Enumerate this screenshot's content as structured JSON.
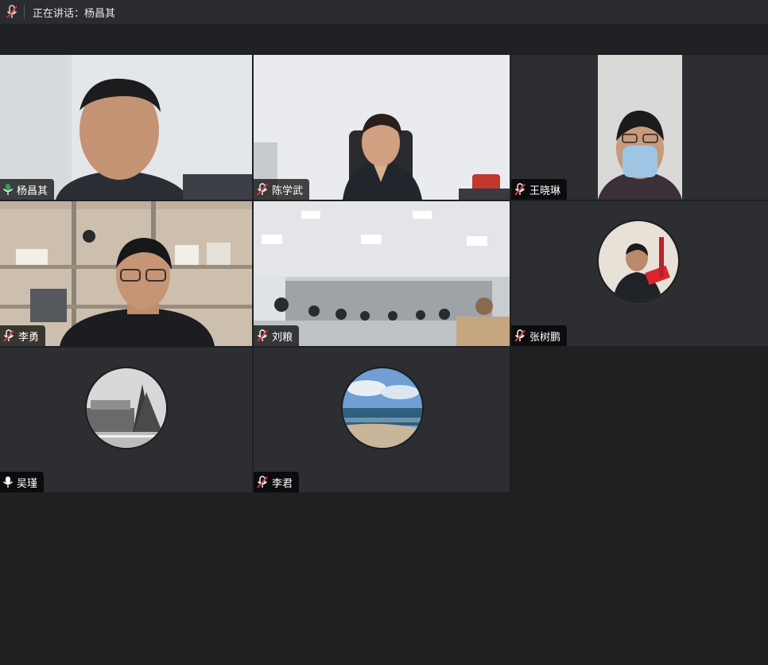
{
  "topbar": {
    "mic_icon": "mic-muted-icon",
    "speaking_label": "正在讲话：杨昌其"
  },
  "participants": [
    {
      "name": "杨昌其",
      "mic": "mic-active-icon",
      "video": "on",
      "active_speaker": true
    },
    {
      "name": "陈学武",
      "mic": "mic-muted-icon",
      "video": "on"
    },
    {
      "name": "王晓琳",
      "mic": "mic-muted-icon",
      "video": "on"
    },
    {
      "name": "李勇",
      "mic": "mic-muted-icon",
      "video": "on"
    },
    {
      "name": "刘粮",
      "mic": "mic-muted-icon",
      "video": "on"
    },
    {
      "name": "张树鹏",
      "mic": "mic-muted-icon",
      "video": "avatar"
    },
    {
      "name": "吴瑾",
      "mic": "mic-icon",
      "video": "avatar"
    },
    {
      "name": "李君",
      "mic": "mic-muted-icon",
      "video": "avatar"
    }
  ],
  "colors": {
    "active_border": "#1ea85a",
    "muted_red": "#e0333a",
    "background": "#1f2022",
    "tile": "#2c2e32"
  }
}
